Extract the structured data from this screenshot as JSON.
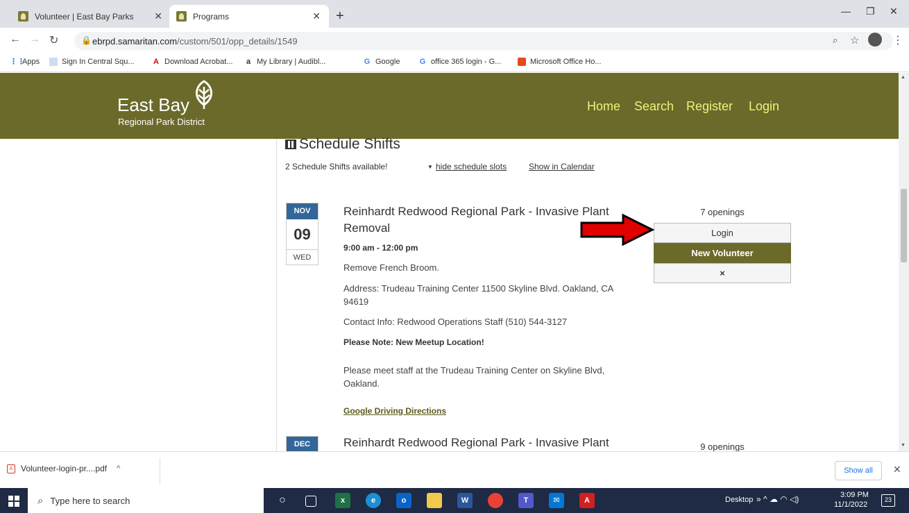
{
  "browser": {
    "tabs": [
      {
        "title": "Volunteer | East Bay Parks"
      },
      {
        "title": "Programs"
      }
    ],
    "url_host": "ebrpd.samaritan.com",
    "url_path": "/custom/501/opp_details/1549",
    "bookmarks": [
      {
        "label": "Apps"
      },
      {
        "label": "Sign In Central Squ..."
      },
      {
        "label": "Download Acrobat..."
      },
      {
        "label": "My Library | Audibl..."
      },
      {
        "label": "Google"
      },
      {
        "label": "office 365 login - G..."
      },
      {
        "label": "Microsoft Office Ho..."
      }
    ]
  },
  "site": {
    "logo_line1": "East Bay",
    "logo_line2": "Regional Park District",
    "nav": [
      "Home",
      "Search",
      "Register",
      "Login"
    ]
  },
  "schedule": {
    "heading": "Schedule Shifts",
    "available": "2 Schedule Shifts available!",
    "hide_slots": "hide schedule slots",
    "show_calendar": "Show in Calendar",
    "events": [
      {
        "month": "NOV",
        "day": "09",
        "weekday": "WED",
        "title": "Reinhardt Redwood Regional Park - Invasive Plant Removal",
        "time": "9:00 am - 12:00 pm",
        "description": "Remove French Broom.",
        "address": "Address: Trudeau Training Center 11500 Skyline Blvd. Oakland, CA 94619",
        "contact": "Contact Info: Redwood Operations Staff (510) 544-3127",
        "note_title": "Please Note: New Meetup Location!",
        "note_text": "Please meet staff at the Trudeau Training Center on Skyline Blvd, Oakland.",
        "directions": "Google Driving Directions",
        "openings": "7 openings",
        "login_label": "Login",
        "new_volunteer_label": "New Volunteer",
        "close_label": "×"
      },
      {
        "month": "DEC",
        "title": "Reinhardt Redwood Regional Park - Invasive Plant",
        "openings": "9 openings"
      }
    ]
  },
  "downloads": {
    "file": "Volunteer-login-pr....pdf",
    "show_all": "Show all"
  },
  "taskbar": {
    "search_placeholder": "Type here to search",
    "desktop_label": "Desktop",
    "time": "3:09 PM",
    "date": "11/1/2022",
    "notifications": "23"
  },
  "colors": {
    "header_olive": "#6b6a2a",
    "nav_text": "#e9f57a",
    "date_month_bg": "#336699",
    "arrow_red": "#e00000"
  }
}
